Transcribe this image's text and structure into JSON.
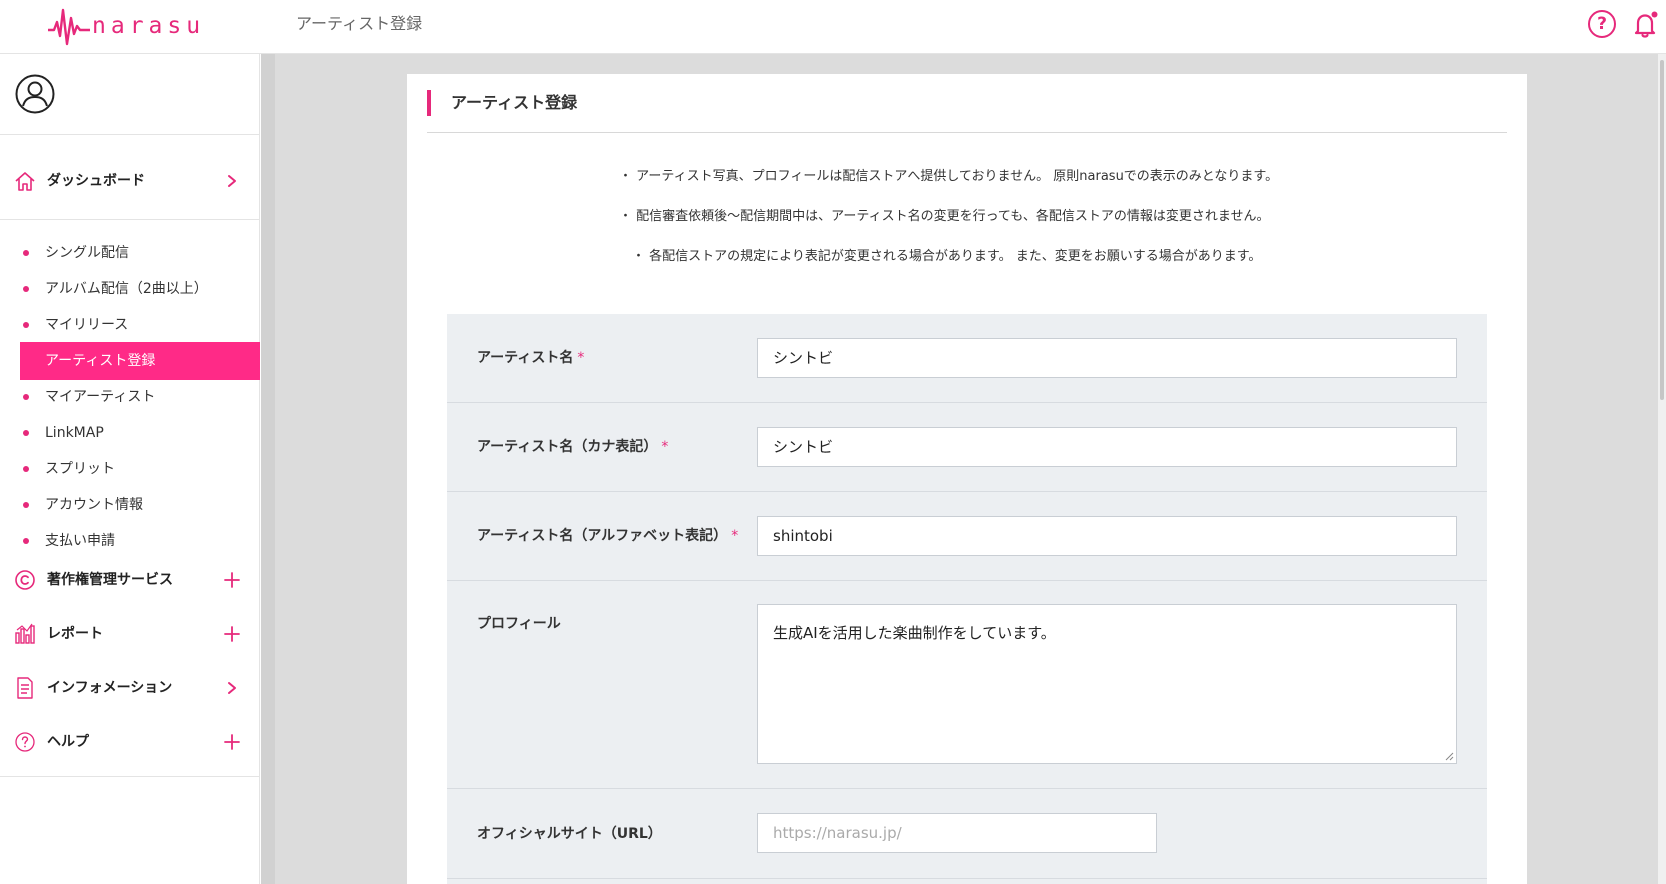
{
  "header": {
    "logo_text": "narasu",
    "page_title": "アーティスト登録",
    "help_glyph": "?",
    "brand_color": "#e6297b"
  },
  "sidebar": {
    "sections_top": [
      {
        "label": "ダッシュボード",
        "icon": "home-icon",
        "control": "chevron-right-icon"
      }
    ],
    "items": [
      {
        "label": "シングル配信",
        "active": false
      },
      {
        "label": "アルバム配信（2曲以上）",
        "active": false
      },
      {
        "label": "マイリリース",
        "active": false
      },
      {
        "label": "アーティスト登録",
        "active": true
      },
      {
        "label": "マイアーティスト",
        "active": false
      },
      {
        "label": "LinkMAP",
        "active": false
      },
      {
        "label": "スプリット",
        "active": false
      },
      {
        "label": "アカウント情報",
        "active": false
      },
      {
        "label": "支払い申請",
        "active": false
      }
    ],
    "sections_bottom": [
      {
        "label": "著作権管理サービス",
        "icon": "copyright-icon",
        "control": "plus-icon"
      },
      {
        "label": "レポート",
        "icon": "chart-icon",
        "control": "plus-icon"
      },
      {
        "label": "インフォメーション",
        "icon": "document-icon",
        "control": "chevron-right-icon"
      },
      {
        "label": "ヘルプ",
        "icon": "help-circle-icon",
        "control": "plus-icon"
      }
    ]
  },
  "card": {
    "title": "アーティスト登録",
    "notes": [
      "・ アーティスト写真、プロフィールは配信ストアへ提供しておりません。 原則narasuでの表示のみとなります。",
      "・ 配信審査依頼後〜配信期間中は、アーティスト名の変更を行っても、各配信ストアの情報は変更されません。",
      "・ 各配信ストアの規定により表記が変更される場合があります。 また、変更をお願いする場合があります。"
    ]
  },
  "form": {
    "required_mark": "*",
    "fields": [
      {
        "label": "アーティスト名",
        "required": true,
        "value": "シントビ",
        "placeholder": ""
      },
      {
        "label": "アーティスト名（カナ表記）",
        "required": true,
        "value": "シントビ",
        "placeholder": ""
      },
      {
        "label": "アーティスト名（アルファベット表記）",
        "required": true,
        "value": "shintobi",
        "placeholder": ""
      },
      {
        "label": "プロフィール",
        "required": false,
        "value": "生成AIを活用した楽曲制作をしています。",
        "placeholder": ""
      },
      {
        "label": "オフィシャルサイト（URL）",
        "required": false,
        "value": "",
        "placeholder": "https://narasu.jp/"
      }
    ]
  }
}
